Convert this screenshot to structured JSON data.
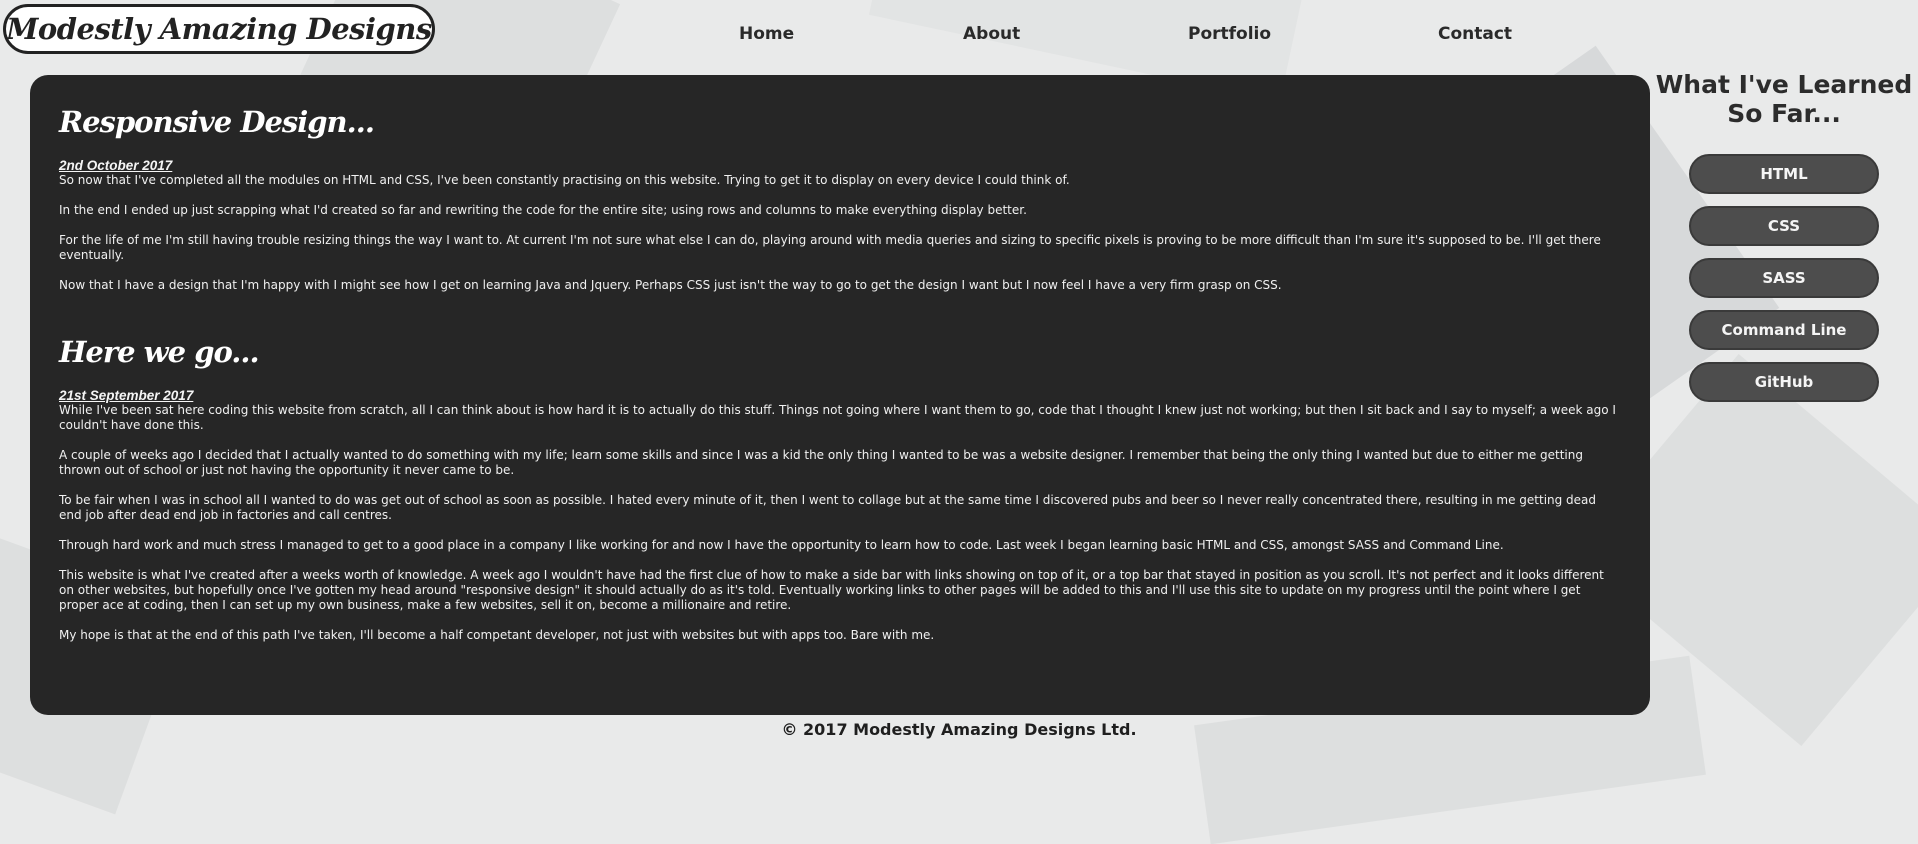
{
  "site": {
    "logo_text": "Modestly Amazing Designs"
  },
  "nav": {
    "home": "Home",
    "about": "About",
    "portfolio": "Portfolio",
    "contact": "Contact"
  },
  "posts": [
    {
      "title": "Responsive Design...",
      "date": "2nd October 2017",
      "paragraphs": [
        "So now that I've completed all the modules on HTML and CSS, I've been constantly practising on this website. Trying to get it to display on every device I could think of.",
        "In the end I ended up just scrapping what I'd created so far and rewriting the code for the entire site; using rows and columns to make everything display better.",
        "For the life of me I'm still having trouble resizing things the way I want to. At current I'm not sure what else I can do, playing around with media queries and sizing to specific pixels is proving to be more difficult than I'm sure it's supposed to be. I'll get there eventually.",
        "Now that I have a design that I'm happy with I might see how I get on learning Java and Jquery. Perhaps CSS just isn't the way to go to get the design I want but I now feel I have a very firm grasp on CSS."
      ]
    },
    {
      "title": "Here we go...",
      "date": "21st September 2017",
      "paragraphs": [
        "While I've been sat here coding this website from scratch, all I can think about is how hard it is to actually do this stuff. Things not going where I want them to go, code that I thought I knew just not working; but then I sit back and I say to myself; a week ago I couldn't have done this.",
        "A couple of weeks ago I decided that I actually wanted to do something with my life; learn some skills and since I was a kid the only thing I wanted to be was a website designer. I remember that being the only thing I wanted but due to either me getting thrown out of school or just not having the opportunity it never came to be.",
        "To be fair when I was in school all I wanted to do was get out of school as soon as possible. I hated every minute of it, then I went to collage but at the same time I discovered pubs and beer so I never really concentrated there, resulting in me getting dead end job after dead end job in factories and call centres.",
        "Through hard work and much stress I managed to get to a good place in a company I like working for and now I have the opportunity to learn how to code. Last week I began learning basic HTML and CSS, amongst SASS and Command Line.",
        "This website is what I've created after a weeks worth of knowledge. A week ago I wouldn't have had the first clue of how to make a side bar with links showing on top of it, or a top bar that stayed in position as you scroll. It's not perfect and it looks different on other websites, but hopefully once I've gotten my head around \"responsive design\" it should actually do as it's told. Eventually working links to other pages will be added to this and I'll use this site to update on my progress until the point where I get proper ace at coding, then I can set up my own business, make a few websites, sell it on, become a millionaire and retire.",
        "My hope is that at the end of this path I've taken, I'll become a half competant developer, not just with websites but with apps too. Bare with me."
      ]
    }
  ],
  "sidebar": {
    "title": "What I've Learned So Far...",
    "buttons": [
      "HTML",
      "CSS",
      "SASS",
      "Command Line",
      "GitHub"
    ]
  },
  "footer": {
    "text": "© 2017 Modestly Amazing Designs Ltd."
  },
  "colors": {
    "page_background": "#e9eaea",
    "content_panel": "#262626",
    "sidebar_button": "#4d4d4d"
  }
}
